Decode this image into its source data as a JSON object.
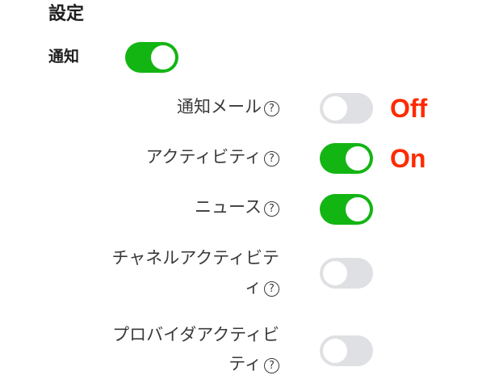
{
  "page": {
    "title": "設定"
  },
  "notifications": {
    "label": "通知",
    "enabled": true
  },
  "settings": [
    {
      "label": "通知メール",
      "label_lines": [
        "通知メール"
      ],
      "enabled": false,
      "state_text": "Off"
    },
    {
      "label": "アクティビティ",
      "label_lines": [
        "アクティビティ"
      ],
      "enabled": true,
      "state_text": "On"
    },
    {
      "label": "ニュース",
      "label_lines": [
        "ニュース"
      ],
      "enabled": true,
      "state_text": ""
    },
    {
      "label": "チャネルアクティビティ",
      "label_lines": [
        "チャネルアクティビテ",
        "ィ"
      ],
      "enabled": false,
      "state_text": ""
    },
    {
      "label": "プロバイダアクティビティ",
      "label_lines": [
        "プロバイダアクティビ",
        "ティ"
      ],
      "enabled": false,
      "state_text": ""
    }
  ],
  "help_icon_glyph": "?",
  "colors": {
    "toggle_on": "#13b513",
    "toggle_off": "#dfe0e3",
    "state_text": "#ff2a00"
  }
}
